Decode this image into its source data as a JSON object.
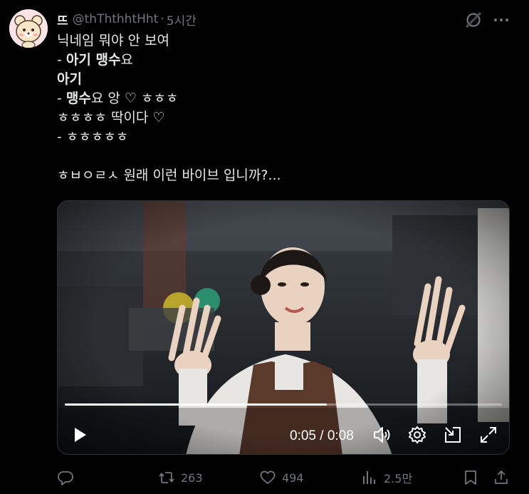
{
  "post": {
    "display_name": "뜨",
    "handle": "@thThthhtHht",
    "separator": "·",
    "time": "5시간",
    "lines": [
      "닉네임 뭐야 안 보여",
      "- 아기 맹수요",
      "아기",
      "- 맹수요 앙 ♡ ㅎㅎㅎ",
      "ㅎㅎㅎㅎ 딱이다 ♡",
      "- ㅎㅎㅎㅎㅎ",
      "",
      "ㅎㅂㅇㄹㅅ 원래 이런 바이브 입니까?..."
    ],
    "line2_prefix": "- ",
    "line2_bold": "아기 맹수",
    "line2_suffix": "요",
    "line3_bold": "아기",
    "line4_prefix": "- ",
    "line4_bold": "맹수",
    "line4_suffix": "요 앙 ♡ ㅎㅎㅎ"
  },
  "video": {
    "elapsed": "0:05",
    "duration": "0:08",
    "time_separator": " / ",
    "progress": 0.6
  },
  "actions": {
    "reply_count": "",
    "retweet_count": "263",
    "like_count": "494",
    "views_count": "2.5만"
  },
  "icons": [
    "grok-icon",
    "more-icon",
    "play-icon",
    "volume-icon",
    "settings-icon",
    "dock-icon",
    "fullscreen-icon",
    "reply-icon",
    "retweet-icon",
    "like-icon",
    "views-icon",
    "bookmark-icon",
    "share-icon"
  ],
  "colors": {
    "background": "#000000",
    "text": "#e7e9ea",
    "muted": "#71767b"
  }
}
